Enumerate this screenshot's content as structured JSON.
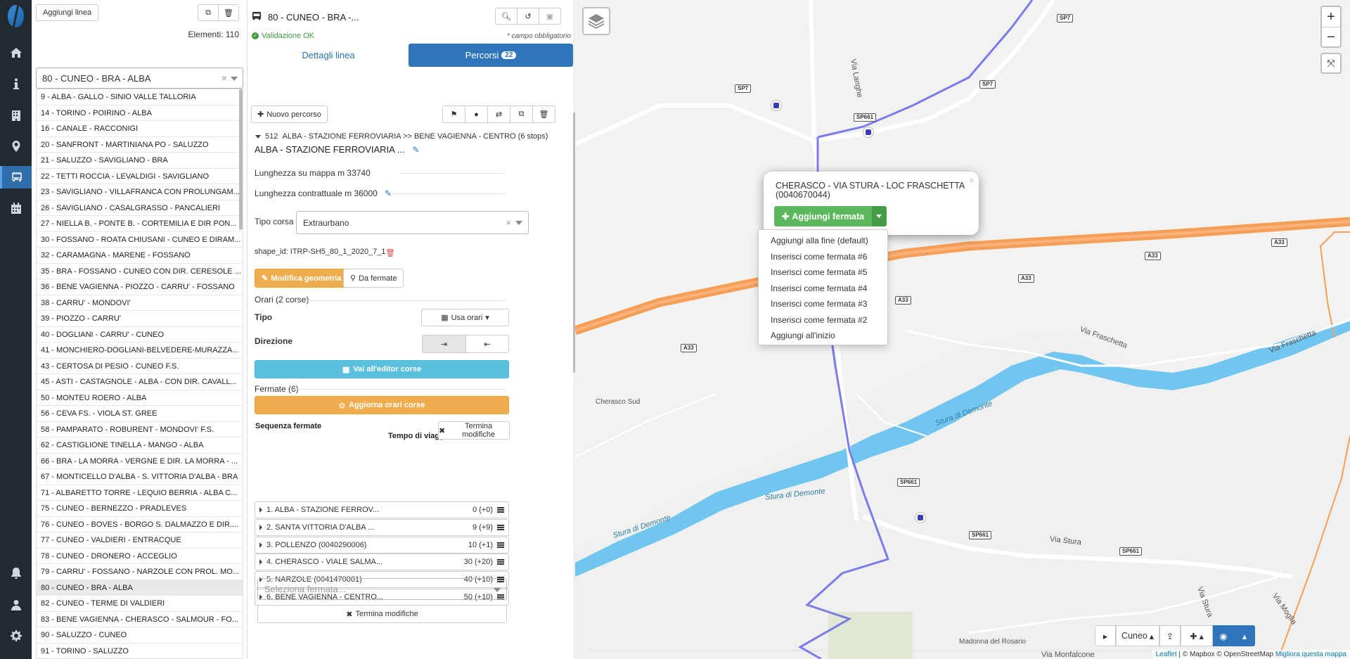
{
  "nav": {
    "items": [
      "home-icon",
      "info-icon",
      "building-icon",
      "map-marker-icon",
      "bus-icon",
      "calendar-icon"
    ],
    "bottom": [
      "bell-icon",
      "user-icon",
      "gear-icon"
    ],
    "active": "bus-icon"
  },
  "lines": {
    "add_button": "Aggiungi linea",
    "count_label": "Elementi: 110",
    "selected": "80 - CUNEO - BRA - ALBA",
    "items": [
      "9 - ALBA - GALLO - SINIO VALLE TALLORIA",
      "14 - TORINO - POIRINO - ALBA",
      "16 - CANALE - RACCONIGI",
      "20 - SANFRONT - MARTINIANA PO - SALUZZO",
      "21 - SALUZZO - SAVIGLIANO - BRA",
      "22 - TETTI ROCCIA - LEVALDIGI - SAVIGLIANO",
      "23 - SAVIGLIANO - VILLAFRANCA CON PROLUNGAM...",
      "26 - SAVIGLIANO - CASALGRASSO - PANCALIERI",
      "27 - NIELLA B. - PONTE B. - CORTEMILIA E DIR PON...",
      "30 - FOSSANO - ROATA CHIUSANI - CUNEO E DIRAM...",
      "32 - CARAMAGNA - MARENE - FOSSANO",
      "35 - BRA - FOSSANO - CUNEO CON DIR. CERESOLE ...",
      "36 - BENE VAGIENNA - PIOZZO - CARRU' - FOSSANO",
      "38 - CARRU' - MONDOVI'",
      "39 - PIOZZO - CARRU'",
      "40 - DOGLIANI - CARRU' - CUNEO",
      "41 - MONCHIERO-DOGLIANI-BELVEDERE-MURAZZA...",
      "43 - CERTOSA DI PESIO - CUNEO F.S.",
      "45 - ASTI - CASTAGNOLE - ALBA - CON DIR. CAVALL...",
      "50 - MONTEU ROERO - ALBA",
      "56 - CEVA FS. - VIOLA ST. GREE",
      "58 - PAMPARATO - ROBURENT - MONDOVI' F.S.",
      "62 - CASTIGLIONE TINELLA - MANGO - ALBA",
      "66 - BRA - LA MORRA - VERGNE E DIR. LA MORRA - ...",
      "67 - MONTICELLO D'ALBA - S. VITTORIA D'ALBA - BRA",
      "71 - ALBARETTO TORRE - LEQUIO BERRIA - ALBA C...",
      "75 - CUNEO - BERNEZZO - PRADLEVES",
      "76 - CUNEO - BOVES - BORGO S. DALMAZZO E DIR....",
      "77 - CUNEO - VALDIERI - ENTRACQUE",
      "78 - CUNEO - DRONERO - ACCEGLIO",
      "79 - CARRU' - FOSSANO - NARZOLE CON PROL. MO...",
      "80 - CUNEO - BRA - ALBA",
      "82 - CUNEO - TERME DI VALDIERI",
      "83 - BENE VAGIENNA - CHERASCO - SALMOUR - FO...",
      "90 - SALUZZO - CUNEO",
      "91 - TORINO - SALUZZO"
    ],
    "active_index": 31
  },
  "editor": {
    "title": "80 - CUNEO - BRA -...",
    "validation": "Validazione OK",
    "required_note": "* campo obbligatorio",
    "tab_details": "Dettagli linea",
    "tab_routes": "Percorsi",
    "routes_count": "22",
    "new_route": "Nuovo percorso",
    "route_header_id": "512",
    "route_header": "ALBA - STAZIONE FERROVIARIA >> BENE VAGIENNA - CENTRO (6 stops)",
    "route_name": "ALBA - STAZIONE FERROVIARIA ...",
    "map_length": "Lunghezza su mappa m 33740",
    "contract_length": "Lunghezza contrattuale m 36000",
    "trip_type_label": "Tipo corsa",
    "trip_type_value": "Extraurbano",
    "shape_id": "shape_id: ITRP-SH5_80_1_2020_7_1",
    "edit_geometry": "Modifica geometria perc.",
    "from_stops": "Da fermate",
    "schedules_label": "Orari (2 corse)",
    "type_label": "Tipo",
    "use_schedules": "Usa orari",
    "direction_label": "Direzione",
    "trip_editor": "Vai all'editor corse",
    "stops_label": "Fermate (6)",
    "update_schedules": "Aggiorna orari corse",
    "sequence_label": "Sequenza fermate",
    "travel_time_label": "Tempo di viaggio",
    "end_edit": "Termina modifiche",
    "stops": [
      {
        "name": "1. ALBA - STAZIONE FERROV...",
        "time": "0 (+0)"
      },
      {
        "name": "2. SANTA VITTORIA D'ALBA ...",
        "time": "9 (+9)"
      },
      {
        "name": "3. POLLENZO (0040290006)",
        "time": "10 (+1)"
      },
      {
        "name": "4. CHERASCO - VIALE SALMA...",
        "time": "30 (+20)"
      },
      {
        "name": "5. NARZOLE (0041470001)",
        "time": "40 (+10)"
      },
      {
        "name": "6. BENE VAGIENNA - CENTRO...",
        "time": "50 (+10)"
      }
    ],
    "select_stop_placeholder": "Seleziona fermata..."
  },
  "map": {
    "popup_title": "CHERASCO - VIA STURA - LOC FRASCHETTA (0040670044)",
    "add_stop": "Aggiungi fermata",
    "menu": [
      "Aggiungi alla fine (default)",
      "Inserisci come fermata #6",
      "Inserisci come fermata #5",
      "Inserisci come fermata #4",
      "Inserisci come fermata #3",
      "Inserisci come fermata #2",
      "Aggiungi all'inizio"
    ],
    "zoom_in": "+",
    "zoom_out": "−",
    "location": "Cuneo",
    "attr_leaflet": "Leaflet",
    "attr_rest": "| © Mapbox © OpenStreetMap",
    "attr_improve": "Migliora questa mappa",
    "labels": {
      "via_langhe": "Via Langhe",
      "via_fraschetta_1": "Via Fraschetta",
      "via_fraschetta_2": "Via Fraschetta",
      "via_stura": "Via Stura",
      "via_stura_2": "Via Stura",
      "via_moglia": "Via Moglia",
      "via_monfalcone": "Via Monfalcone",
      "cherasco_sud": "Cherasco Sud",
      "madonna": "Madonna del Rosario",
      "stura_1": "Stura di Demonte",
      "stura_2": "Stura di Demonte",
      "stura_3": "Stura di Demonte"
    },
    "shields": {
      "sp7a": "SP7",
      "sp7b": "SP7",
      "sp7c": "SP7",
      "sp661a": "SP661",
      "sp661b": "SP661",
      "sp661c": "SP661",
      "sp661d": "SP661",
      "a33a": "A33",
      "a33b": "A33",
      "a33c": "A33",
      "a33d": "A33",
      "a33e": "A33"
    },
    "colors": {
      "route": "#7b7bea",
      "highway": "#f59e57",
      "river": "#6fc6ee"
    }
  }
}
